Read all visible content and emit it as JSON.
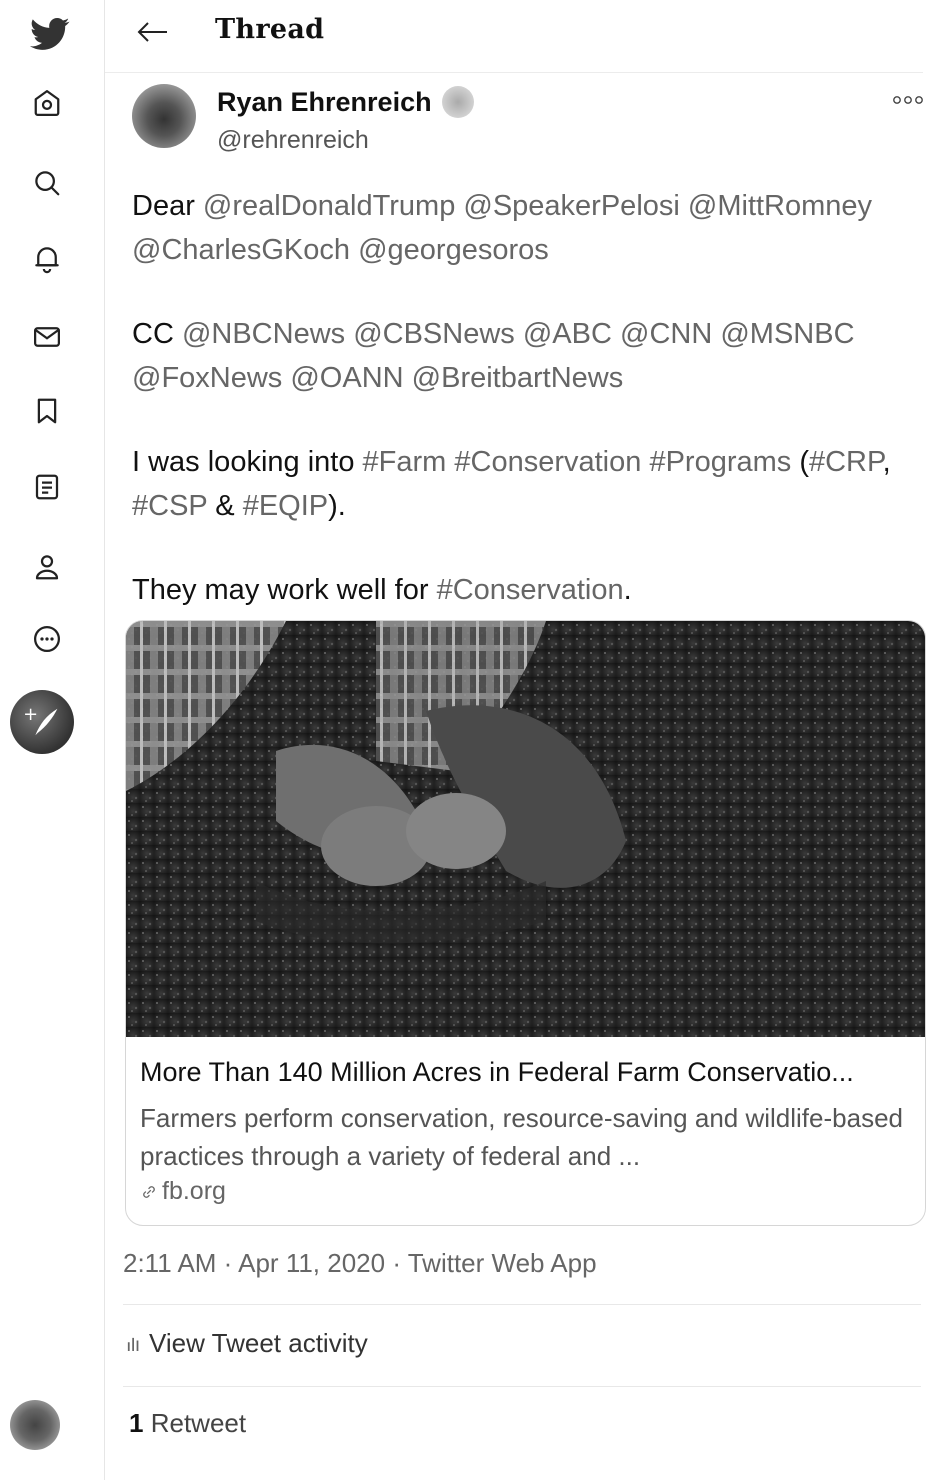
{
  "header": {
    "title": "Thread"
  },
  "tweet": {
    "author_name": "Ryan Ehrenreich",
    "author_handle": "@rehrenreich",
    "paragraphs": [
      [
        {
          "t": "Dear ",
          "k": "text"
        },
        {
          "t": "@realDonaldTrump",
          "k": "mention"
        },
        {
          "t": " ",
          "k": "text"
        },
        {
          "t": "@SpeakerPelosi",
          "k": "mention"
        },
        {
          "t": " ",
          "k": "text"
        },
        {
          "t": "@MittRomney",
          "k": "mention"
        },
        {
          "t": " ",
          "k": "text"
        },
        {
          "t": "@CharlesGKoch",
          "k": "mention"
        },
        {
          "t": " ",
          "k": "text"
        },
        {
          "t": "@georgesoros",
          "k": "mention"
        }
      ],
      [
        {
          "t": "CC ",
          "k": "text"
        },
        {
          "t": "@NBCNews",
          "k": "mention"
        },
        {
          "t": " ",
          "k": "text"
        },
        {
          "t": "@CBSNews",
          "k": "mention"
        },
        {
          "t": " ",
          "k": "text"
        },
        {
          "t": "@ABC",
          "k": "mention"
        },
        {
          "t": " ",
          "k": "text"
        },
        {
          "t": "@CNN",
          "k": "mention"
        },
        {
          "t": " ",
          "k": "text"
        },
        {
          "t": "@MSNBC",
          "k": "mention"
        },
        {
          "t": " ",
          "k": "text"
        },
        {
          "t": "@FoxNews",
          "k": "mention"
        },
        {
          "t": " ",
          "k": "text"
        },
        {
          "t": "@OANN",
          "k": "mention"
        },
        {
          "t": " ",
          "k": "text"
        },
        {
          "t": "@BreitbartNews",
          "k": "mention"
        }
      ],
      [
        {
          "t": "I was looking into ",
          "k": "text"
        },
        {
          "t": "#Farm",
          "k": "hashtag"
        },
        {
          "t": " ",
          "k": "text"
        },
        {
          "t": "#Conservation",
          "k": "hashtag"
        },
        {
          "t": " ",
          "k": "text"
        },
        {
          "t": "#Programs",
          "k": "hashtag"
        },
        {
          "t": " (",
          "k": "text"
        },
        {
          "t": "#CRP",
          "k": "hashtag"
        },
        {
          "t": ", ",
          "k": "text"
        },
        {
          "t": "#CSP",
          "k": "hashtag"
        },
        {
          "t": " & ",
          "k": "text"
        },
        {
          "t": "#EQIP",
          "k": "hashtag"
        },
        {
          "t": ").",
          "k": "text"
        }
      ],
      [
        {
          "t": "They may work well for ",
          "k": "text"
        },
        {
          "t": "#Conservation",
          "k": "hashtag"
        },
        {
          "t": ".",
          "k": "text"
        }
      ]
    ],
    "card": {
      "title": "More Than 140 Million Acres in Federal Farm Conservatio...",
      "description": "Farmers perform conservation, resource-saving and wildlife-based practices through a variety of federal and ...",
      "domain": "fb.org"
    },
    "timestamp": "2:11 AM · Apr 11, 2020 · Twitter Web App",
    "activity_label": "View Tweet activity",
    "retweet_count": "1",
    "retweet_label": "Retweet"
  },
  "icons": {
    "sidebar": [
      "twitter-logo-icon",
      "home-icon",
      "search-icon",
      "bell-icon",
      "mail-icon",
      "bookmark-icon",
      "list-icon",
      "profile-icon",
      "more-circle-icon",
      "compose-tweet-icon"
    ]
  },
  "colors": {
    "link_gray": "#666666",
    "border": "#d6d6d6"
  }
}
